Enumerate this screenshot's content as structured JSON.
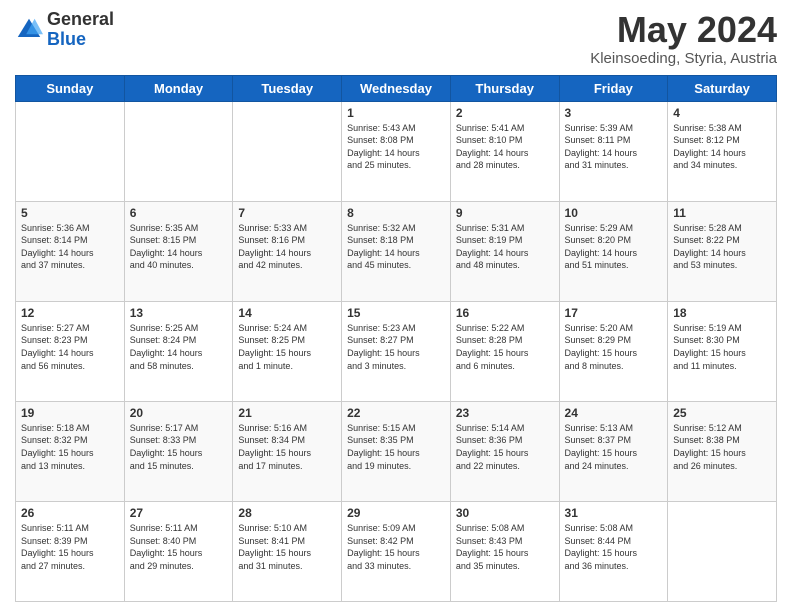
{
  "header": {
    "logo_general": "General",
    "logo_blue": "Blue",
    "month_title": "May 2024",
    "location": "Kleinsoeding, Styria, Austria"
  },
  "days_of_week": [
    "Sunday",
    "Monday",
    "Tuesday",
    "Wednesday",
    "Thursday",
    "Friday",
    "Saturday"
  ],
  "weeks": [
    [
      {
        "day": "",
        "info": ""
      },
      {
        "day": "",
        "info": ""
      },
      {
        "day": "",
        "info": ""
      },
      {
        "day": "1",
        "info": "Sunrise: 5:43 AM\nSunset: 8:08 PM\nDaylight: 14 hours\nand 25 minutes."
      },
      {
        "day": "2",
        "info": "Sunrise: 5:41 AM\nSunset: 8:10 PM\nDaylight: 14 hours\nand 28 minutes."
      },
      {
        "day": "3",
        "info": "Sunrise: 5:39 AM\nSunset: 8:11 PM\nDaylight: 14 hours\nand 31 minutes."
      },
      {
        "day": "4",
        "info": "Sunrise: 5:38 AM\nSunset: 8:12 PM\nDaylight: 14 hours\nand 34 minutes."
      }
    ],
    [
      {
        "day": "5",
        "info": "Sunrise: 5:36 AM\nSunset: 8:14 PM\nDaylight: 14 hours\nand 37 minutes."
      },
      {
        "day": "6",
        "info": "Sunrise: 5:35 AM\nSunset: 8:15 PM\nDaylight: 14 hours\nand 40 minutes."
      },
      {
        "day": "7",
        "info": "Sunrise: 5:33 AM\nSunset: 8:16 PM\nDaylight: 14 hours\nand 42 minutes."
      },
      {
        "day": "8",
        "info": "Sunrise: 5:32 AM\nSunset: 8:18 PM\nDaylight: 14 hours\nand 45 minutes."
      },
      {
        "day": "9",
        "info": "Sunrise: 5:31 AM\nSunset: 8:19 PM\nDaylight: 14 hours\nand 48 minutes."
      },
      {
        "day": "10",
        "info": "Sunrise: 5:29 AM\nSunset: 8:20 PM\nDaylight: 14 hours\nand 51 minutes."
      },
      {
        "day": "11",
        "info": "Sunrise: 5:28 AM\nSunset: 8:22 PM\nDaylight: 14 hours\nand 53 minutes."
      }
    ],
    [
      {
        "day": "12",
        "info": "Sunrise: 5:27 AM\nSunset: 8:23 PM\nDaylight: 14 hours\nand 56 minutes."
      },
      {
        "day": "13",
        "info": "Sunrise: 5:25 AM\nSunset: 8:24 PM\nDaylight: 14 hours\nand 58 minutes."
      },
      {
        "day": "14",
        "info": "Sunrise: 5:24 AM\nSunset: 8:25 PM\nDaylight: 15 hours\nand 1 minute."
      },
      {
        "day": "15",
        "info": "Sunrise: 5:23 AM\nSunset: 8:27 PM\nDaylight: 15 hours\nand 3 minutes."
      },
      {
        "day": "16",
        "info": "Sunrise: 5:22 AM\nSunset: 8:28 PM\nDaylight: 15 hours\nand 6 minutes."
      },
      {
        "day": "17",
        "info": "Sunrise: 5:20 AM\nSunset: 8:29 PM\nDaylight: 15 hours\nand 8 minutes."
      },
      {
        "day": "18",
        "info": "Sunrise: 5:19 AM\nSunset: 8:30 PM\nDaylight: 15 hours\nand 11 minutes."
      }
    ],
    [
      {
        "day": "19",
        "info": "Sunrise: 5:18 AM\nSunset: 8:32 PM\nDaylight: 15 hours\nand 13 minutes."
      },
      {
        "day": "20",
        "info": "Sunrise: 5:17 AM\nSunset: 8:33 PM\nDaylight: 15 hours\nand 15 minutes."
      },
      {
        "day": "21",
        "info": "Sunrise: 5:16 AM\nSunset: 8:34 PM\nDaylight: 15 hours\nand 17 minutes."
      },
      {
        "day": "22",
        "info": "Sunrise: 5:15 AM\nSunset: 8:35 PM\nDaylight: 15 hours\nand 19 minutes."
      },
      {
        "day": "23",
        "info": "Sunrise: 5:14 AM\nSunset: 8:36 PM\nDaylight: 15 hours\nand 22 minutes."
      },
      {
        "day": "24",
        "info": "Sunrise: 5:13 AM\nSunset: 8:37 PM\nDaylight: 15 hours\nand 24 minutes."
      },
      {
        "day": "25",
        "info": "Sunrise: 5:12 AM\nSunset: 8:38 PM\nDaylight: 15 hours\nand 26 minutes."
      }
    ],
    [
      {
        "day": "26",
        "info": "Sunrise: 5:11 AM\nSunset: 8:39 PM\nDaylight: 15 hours\nand 27 minutes."
      },
      {
        "day": "27",
        "info": "Sunrise: 5:11 AM\nSunset: 8:40 PM\nDaylight: 15 hours\nand 29 minutes."
      },
      {
        "day": "28",
        "info": "Sunrise: 5:10 AM\nSunset: 8:41 PM\nDaylight: 15 hours\nand 31 minutes."
      },
      {
        "day": "29",
        "info": "Sunrise: 5:09 AM\nSunset: 8:42 PM\nDaylight: 15 hours\nand 33 minutes."
      },
      {
        "day": "30",
        "info": "Sunrise: 5:08 AM\nSunset: 8:43 PM\nDaylight: 15 hours\nand 35 minutes."
      },
      {
        "day": "31",
        "info": "Sunrise: 5:08 AM\nSunset: 8:44 PM\nDaylight: 15 hours\nand 36 minutes."
      },
      {
        "day": "",
        "info": ""
      }
    ]
  ]
}
